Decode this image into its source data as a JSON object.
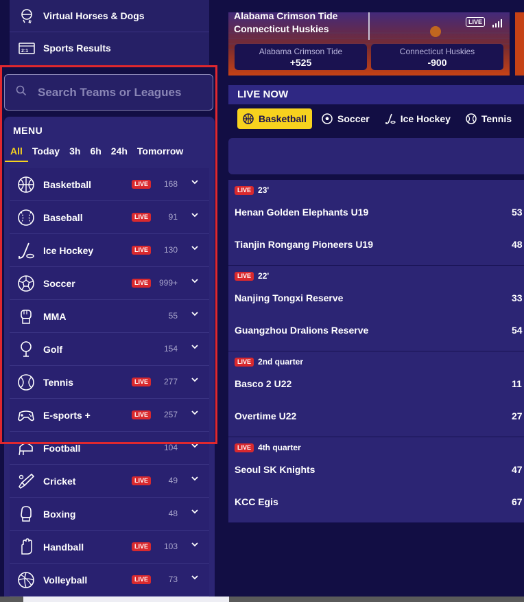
{
  "sidebar": {
    "top_items": [
      {
        "label": "Virtual Horses & Dogs",
        "icon": "horse-dog-icon"
      },
      {
        "label": "Sports Results",
        "icon": "scoreboard-icon"
      }
    ],
    "search": {
      "placeholder": "Search Teams or Leagues"
    },
    "menu_title": "MENU",
    "filters": [
      "All",
      "Today",
      "3h",
      "6h",
      "24h",
      "Tomorrow"
    ],
    "active_filter": "All",
    "live_label": "LIVE",
    "sports": [
      {
        "name": "Basketball",
        "icon": "basketball-icon",
        "live": true,
        "count": "168"
      },
      {
        "name": "Baseball",
        "icon": "baseball-icon",
        "live": true,
        "count": "91"
      },
      {
        "name": "Ice Hockey",
        "icon": "ice-hockey-icon",
        "live": true,
        "count": "130"
      },
      {
        "name": "Soccer",
        "icon": "soccer-ball-icon",
        "live": true,
        "count": "999+"
      },
      {
        "name": "MMA",
        "icon": "mma-glove-icon",
        "live": false,
        "count": "55"
      },
      {
        "name": "Golf",
        "icon": "golf-icon",
        "live": false,
        "count": "154"
      },
      {
        "name": "Tennis",
        "icon": "tennis-ball-icon",
        "live": true,
        "count": "277"
      },
      {
        "name": "E-sports +",
        "icon": "gamepad-icon",
        "live": true,
        "count": "257"
      },
      {
        "name": "Football",
        "icon": "football-icon",
        "live": false,
        "count": "104"
      },
      {
        "name": "Cricket",
        "icon": "cricket-bat-icon",
        "live": true,
        "count": "49"
      },
      {
        "name": "Boxing",
        "icon": "boxing-glove-icon",
        "live": false,
        "count": "48"
      },
      {
        "name": "Handball",
        "icon": "handball-icon",
        "live": true,
        "count": "103"
      },
      {
        "name": "Volleyball",
        "icon": "volleyball-icon",
        "live": true,
        "count": "73"
      }
    ]
  },
  "featured": {
    "team1": "Alabama Crimson Tide",
    "team2": "Connecticut Huskies",
    "live_label": "LIVE",
    "odds": [
      {
        "team": "Alabama Crimson Tide",
        "value": "+525"
      },
      {
        "team": "Connecticut Huskies",
        "value": "-900"
      }
    ]
  },
  "live_now": {
    "title": "LIVE NOW",
    "tabs": [
      {
        "label": "Basketball",
        "icon": "basketball-icon",
        "active": true
      },
      {
        "label": "Soccer",
        "icon": "soccer-ball-icon",
        "active": false
      },
      {
        "label": "Ice Hockey",
        "icon": "ice-hockey-icon",
        "active": false
      },
      {
        "label": "Tennis",
        "icon": "tennis-ball-icon",
        "active": false
      }
    ]
  },
  "matches": [
    {
      "status": "23'",
      "home": "Henan Golden Elephants U19",
      "home_score": "53",
      "away": "Tianjin Rongang Pioneers U19",
      "away_score": "48"
    },
    {
      "status": "22'",
      "home": "Nanjing Tongxi Reserve",
      "home_score": "33",
      "away": "Guangzhou Dralions Reserve",
      "away_score": "54"
    },
    {
      "status": "2nd quarter",
      "home": "Basco 2 U22",
      "home_score": "11",
      "away": "Overtime U22",
      "away_score": "27"
    },
    {
      "status": "4th quarter",
      "home": "Seoul SK Knights",
      "home_score": "47",
      "away": "KCC Egis",
      "away_score": "67"
    }
  ],
  "colors": {
    "accent": "#f7d21e",
    "live": "#d9292e",
    "highlight_box": "#e0282f",
    "bg": "#120e44",
    "panel": "#2c2574"
  }
}
